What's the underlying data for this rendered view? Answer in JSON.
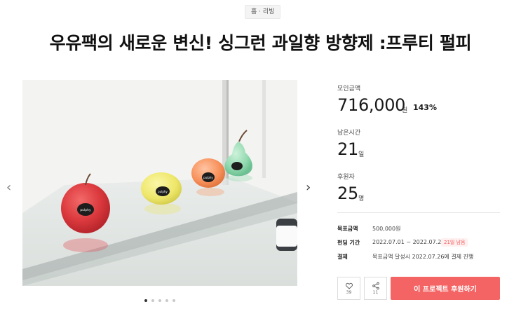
{
  "category": "홈 · 리빙",
  "title": "우유팩의 새로운 변신! 싱그런 과일향 방향제 :프루티 펄피",
  "product_label": "pulphy",
  "funding": {
    "amount_label": "모인금액",
    "amount": "716,000",
    "amount_unit": "원",
    "percent": "143%",
    "time_label": "남은시간",
    "days_left": "21",
    "days_unit": "일",
    "backers_label": "후원자",
    "backers": "25",
    "backers_unit": "명"
  },
  "info": {
    "goal_label": "목표금액",
    "goal_value": "500,000원",
    "period_label": "펀딩 기간",
    "period_value": "2022.07.01 ~ 2022.07.25",
    "period_badge": "21일 남음",
    "payment_label": "결제",
    "payment_value": "목표금액 달성시 2022.07.26에 결제 진행"
  },
  "actions": {
    "like_count": "39",
    "share_count": "11",
    "back_button": "이 프로젝트 후원하기"
  },
  "gallery": {
    "slide_count": 5,
    "active_slide": 1
  },
  "colors": {
    "accent": "#f46464",
    "badge_bg": "#fff0f0",
    "badge_text": "#f05a5a"
  }
}
